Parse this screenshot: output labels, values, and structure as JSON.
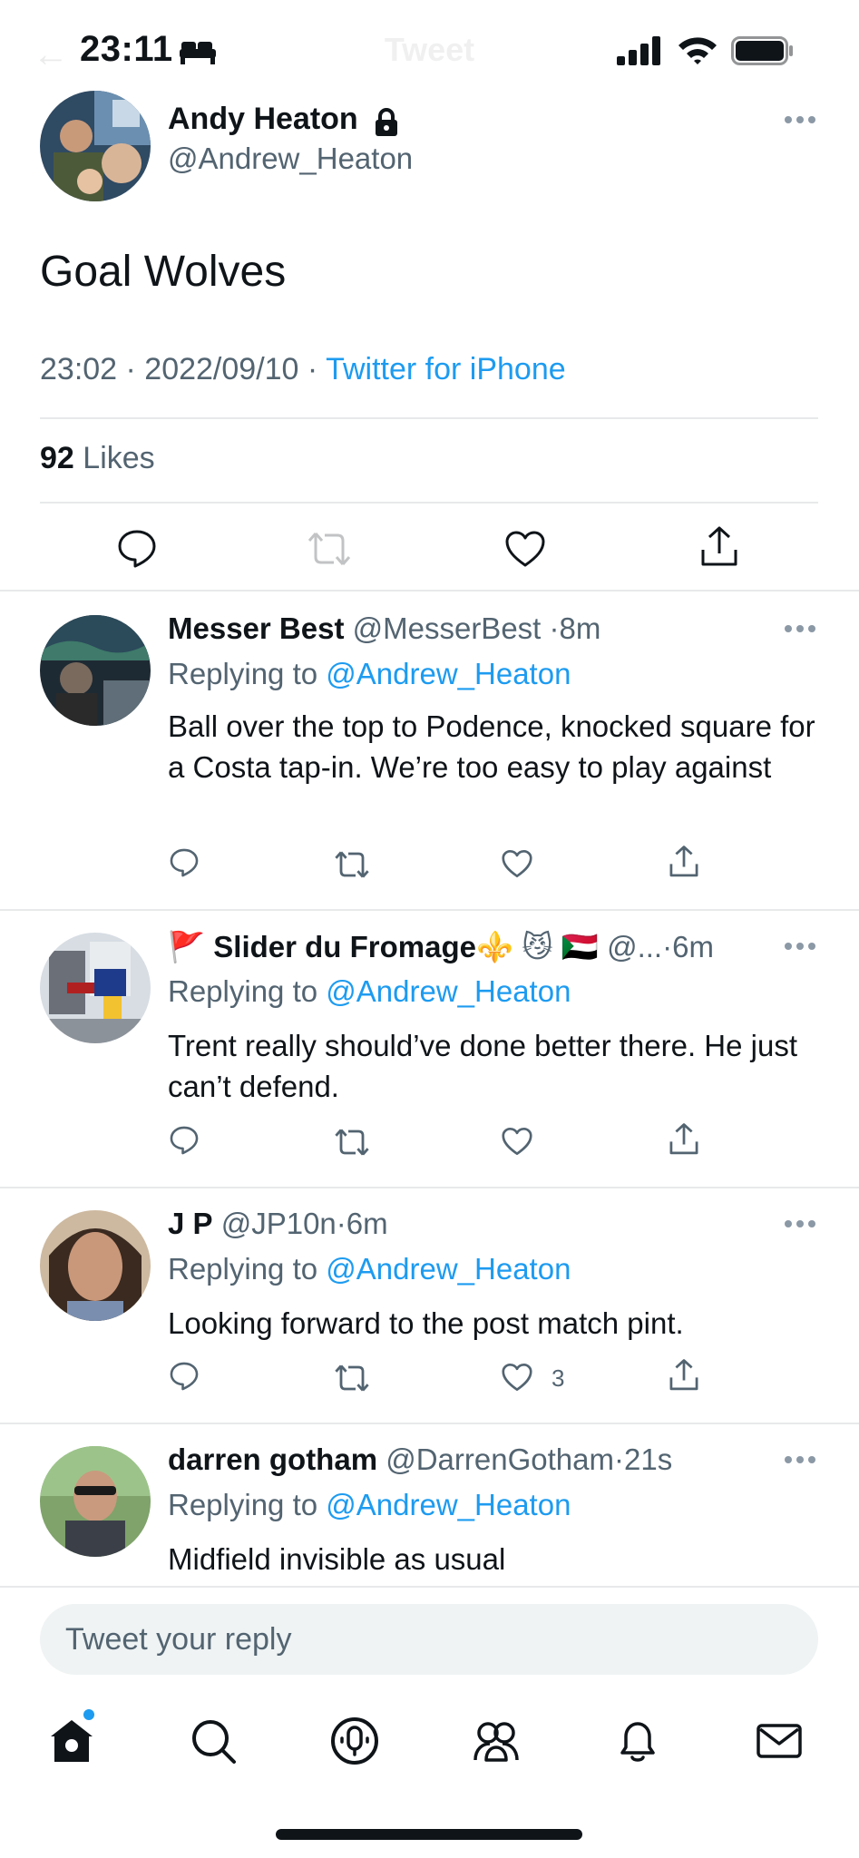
{
  "status_bar": {
    "time": "23:11",
    "icons": [
      "bed-icon",
      "signal-icon",
      "wifi-icon",
      "battery-icon"
    ]
  },
  "header": {
    "title": "Tweet",
    "back_icon": "arrow-left-icon"
  },
  "main_tweet": {
    "author_name": "Andy Heaton",
    "author_handle": "@Andrew_Heaton",
    "protected_icon": "lock-icon",
    "text": "Goal Wolves",
    "timestamp": "23:02 · 2022/09/10 · ",
    "source": "Twitter for iPhone",
    "likes_count": "92",
    "likes_label": "Likes",
    "actions": [
      "reply-icon",
      "retweet-icon",
      "like-icon",
      "share-icon"
    ]
  },
  "replies": [
    {
      "name": "Messer Best",
      "handle": "@MesserBest",
      "time": "8m",
      "replying_to_label": "Replying to ",
      "replying_to": "@Andrew_Heaton",
      "text": "Ball over the top to Podence, knocked square for a Costa tap-in. We’re too easy to play against",
      "like_count": ""
    },
    {
      "name": "Slider du Fromage",
      "name_prefix_emoji": "🚩",
      "name_suffix_emoji": "⚜️ 😼 🇸🇩",
      "handle": "@...",
      "time": "6m",
      "replying_to_label": "Replying to ",
      "replying_to": "@Andrew_Heaton",
      "text": "Trent really should’ve done better there. He just can’t defend.",
      "like_count": ""
    },
    {
      "name": "J P",
      "handle": "@JP10n",
      "time": "6m",
      "replying_to_label": "Replying to ",
      "replying_to": "@Andrew_Heaton",
      "text": "Looking forward to the post match pint.",
      "like_count": "3"
    },
    {
      "name": "darren gotham",
      "handle": "@DarrenGotham",
      "time": "21s",
      "replying_to_label": "Replying to ",
      "replying_to": "@Andrew_Heaton",
      "text": "Midfield invisible as usual",
      "like_count": ""
    }
  ],
  "composer": {
    "placeholder": "Tweet your reply"
  },
  "tab_bar": {
    "tabs": [
      "home-icon",
      "search-icon",
      "spaces-icon",
      "communities-icon",
      "notifications-icon",
      "messages-icon"
    ],
    "active": "home-icon"
  },
  "colors": {
    "accent": "#1d9bf0",
    "text_primary": "#0f1419",
    "text_secondary": "#536471",
    "divider": "#e7e9ea",
    "composer_bg": "#eff3f4"
  }
}
